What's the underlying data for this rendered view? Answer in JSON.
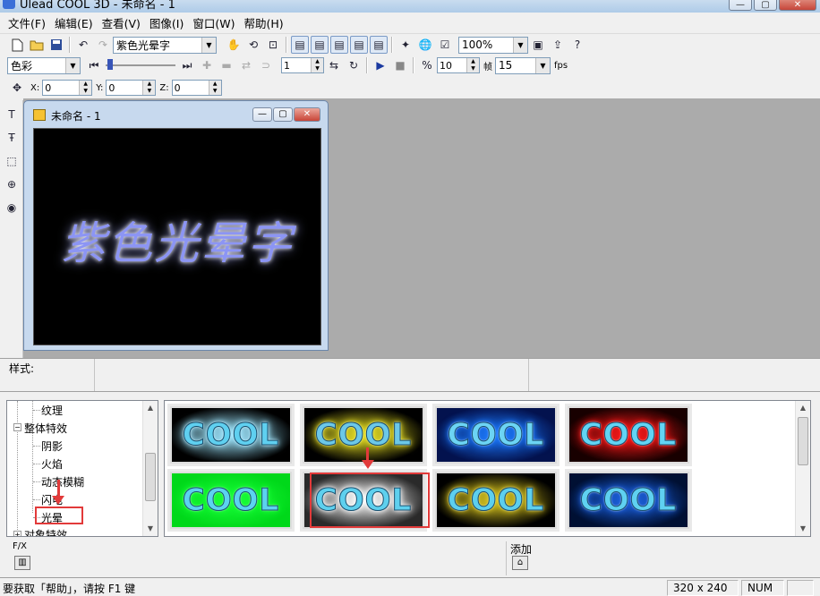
{
  "window": {
    "title": "Ulead COOL 3D - 未命名 - 1",
    "min": "—",
    "max": "▢",
    "close": "✕"
  },
  "menu": [
    "文件(F)",
    "编辑(E)",
    "查看(V)",
    "图像(I)",
    "窗口(W)",
    "帮助(H)"
  ],
  "toolbar1": {
    "text_object": "紫色光晕字",
    "zoom": "100%"
  },
  "toolbar2": {
    "property": "色彩",
    "frame_value": "1",
    "frames_total": "10",
    "frames_label": "帧",
    "fps_value": "15",
    "fps_label": "fps"
  },
  "toolbar3": {
    "x_label": "X:",
    "x_value": "0",
    "y_label": "Y:",
    "y_value": "0",
    "z_label": "Z:",
    "z_value": "0"
  },
  "document": {
    "title": "未命名 - 1",
    "canvas_text": "紫色光晕字",
    "canvas_text_color": "#8c95f4"
  },
  "style_bar": {
    "label": "样式:"
  },
  "tree": {
    "items": [
      {
        "label": "纹理",
        "level": 2
      },
      {
        "label": "整体特效",
        "level": 1,
        "expanded": true
      },
      {
        "label": "阴影",
        "level": 2
      },
      {
        "label": "火焰",
        "level": 2
      },
      {
        "label": "动态模糊",
        "level": 2
      },
      {
        "label": "闪电",
        "level": 2
      },
      {
        "label": "光晕",
        "level": 2,
        "selected": true
      },
      {
        "label": "对象特效",
        "level": 1,
        "expanded": false
      }
    ]
  },
  "gallery": {
    "thumbs": [
      {
        "text": "COOL",
        "bg": "#000000",
        "glow": "#9fe6ff",
        "fg": "#5fd0f0"
      },
      {
        "text": "COOL",
        "bg": "#000000",
        "glow": "#e8e026",
        "fg": "#6cc8e8"
      },
      {
        "text": "COOL",
        "bg": "#03124e",
        "glow": "#1e7bff",
        "fg": "#6cd4f4"
      },
      {
        "text": "COOL",
        "bg": "#180000",
        "glow": "#ff1b1b",
        "fg": "#62d4f4"
      },
      {
        "text": "COOL",
        "bg": "#00d81a",
        "glow": "#1bff3a",
        "fg": "#5cd2f0"
      },
      {
        "text": "COOL",
        "bg": "#2a2a2a",
        "glow": "#ffffff",
        "fg": "#5ed0ee"
      },
      {
        "text": "COOL",
        "bg": "#000000",
        "glow": "#d9c623",
        "fg": "#5dcfee"
      },
      {
        "text": "COOL",
        "bg": "#001033",
        "glow": "#1e63e0",
        "fg": "#5fd1f1"
      }
    ]
  },
  "bottom": {
    "fx_label": "F/X",
    "add_label": "添加"
  },
  "statusbar": {
    "help": "要获取「帮助」，请按 F1 键",
    "size": "320 x 240",
    "num": "NUM"
  },
  "accent_red": "#e23a3a"
}
